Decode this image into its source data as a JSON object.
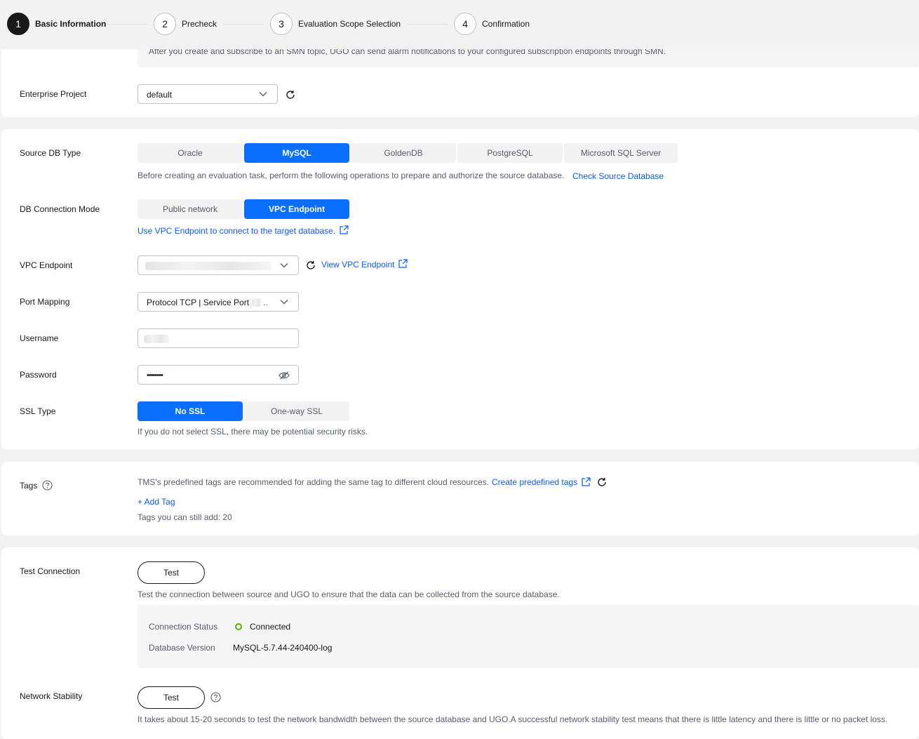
{
  "steps": [
    {
      "num": "1",
      "label": "Basic Information"
    },
    {
      "num": "2",
      "label": "Precheck"
    },
    {
      "num": "3",
      "label": "Evaluation Scope Selection"
    },
    {
      "num": "4",
      "label": "Confirmation"
    }
  ],
  "smn_hint": "After you create and subscribe to an SMN topic, UGO can send alarm notifications to your configured subscription endpoints through SMN.",
  "enterprise_project": {
    "label": "Enterprise Project",
    "value": "default"
  },
  "source_db": {
    "label": "Source DB Type",
    "options": [
      "Oracle",
      "MySQL",
      "GoldenDB",
      "PostgreSQL",
      "Microsoft SQL Server"
    ],
    "selected": "MySQL",
    "hint": "Before creating an evaluation task, perform the following operations to prepare and authorize the source database.",
    "hint_link": "Check Source Database"
  },
  "connection_mode": {
    "label": "DB Connection Mode",
    "options": [
      "Public network",
      "VPC Endpoint"
    ],
    "selected": "VPC Endpoint",
    "link": "Use VPC Endpoint to connect to the target database."
  },
  "vpc_endpoint": {
    "label": "VPC Endpoint",
    "view_link": "View VPC Endpoint"
  },
  "port_mapping": {
    "label": "Port Mapping",
    "value": "Protocol TCP | Service Port",
    "suffix": ".."
  },
  "username": {
    "label": "Username"
  },
  "password": {
    "label": "Password",
    "value": "••••••••"
  },
  "ssl": {
    "label": "SSL Type",
    "options": [
      "No SSL",
      "One-way SSL"
    ],
    "selected": "No SSL",
    "hint": "If you do not select SSL, there may be potential security risks."
  },
  "tags": {
    "label": "Tags",
    "hint": "TMS's predefined tags are recommended for adding the same tag to different cloud resources.",
    "create_link": "Create predefined tags",
    "add_tag": "+ Add Tag",
    "remaining": "Tags you can still add: 20"
  },
  "test_connection": {
    "label": "Test Connection",
    "button": "Test",
    "hint": "Test the connection between source and UGO to ensure that the data can be collected from the source database.",
    "status_label": "Connection Status",
    "status_value": "Connected",
    "version_label": "Database Version",
    "version_value": "MySQL-5.7.44-240400-log"
  },
  "network_stability": {
    "label": "Network Stability",
    "button": "Test",
    "hint": "It takes about 15-20 seconds to test the network bandwidth between the source database and UGO.A successful network stability test means that there is little latency and there is little or no packet loss."
  },
  "colors": {
    "primary": "#0a6eff",
    "link": "#0a59ff",
    "success": "#5cb300"
  }
}
